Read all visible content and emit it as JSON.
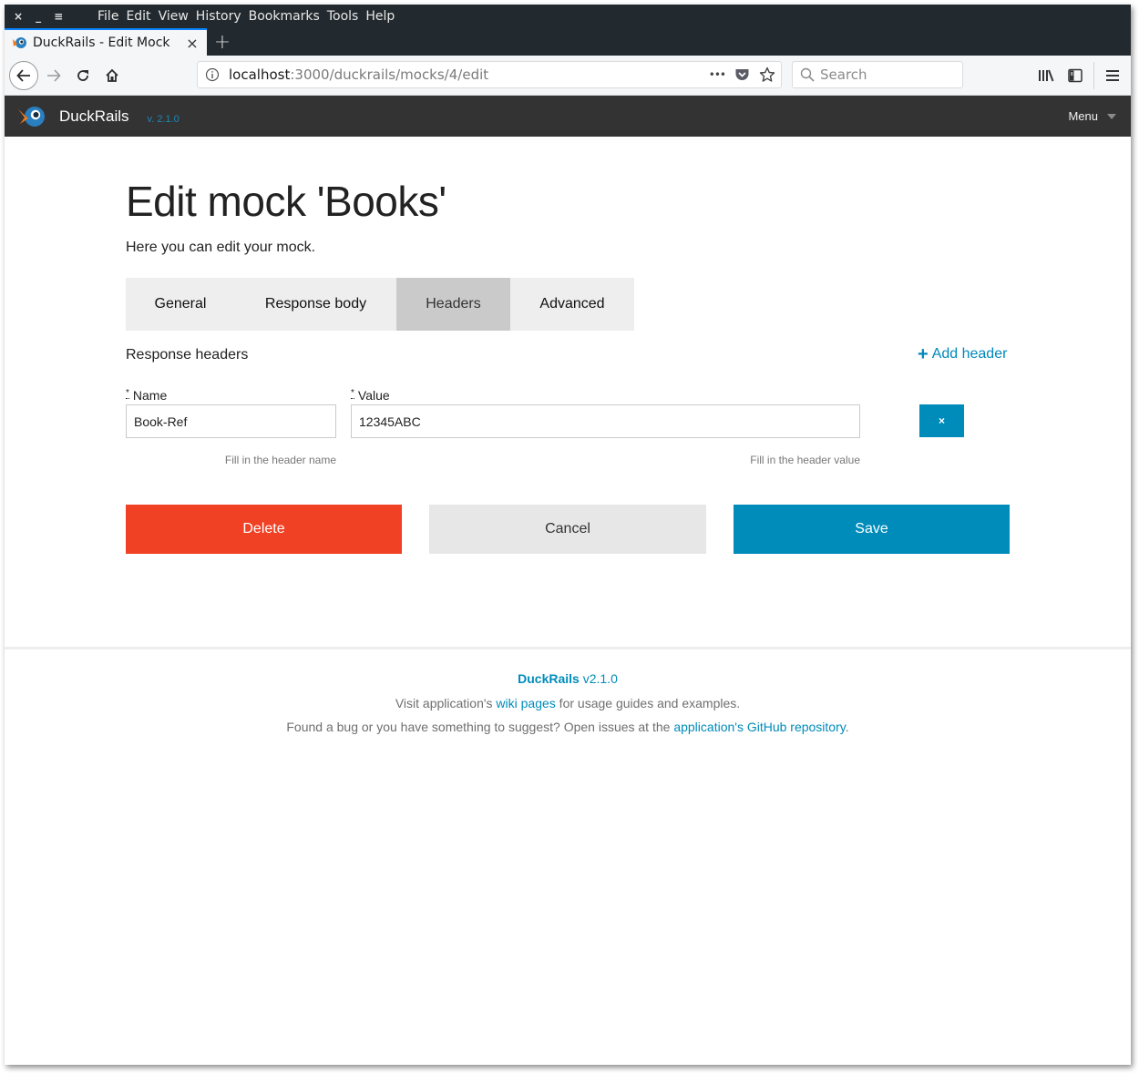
{
  "browser": {
    "window_controls": {
      "close": "×",
      "minimize": "_",
      "maximize": "≡"
    },
    "menu": [
      "File",
      "Edit",
      "View",
      "History",
      "Bookmarks",
      "Tools",
      "Help"
    ],
    "tab": {
      "title": "DuckRails - Edit Mock",
      "close": "×"
    },
    "new_tab": "+",
    "url": {
      "host": "localhost",
      "rest": ":3000/duckrails/mocks/4/edit"
    },
    "page_actions": "•••",
    "search": {
      "placeholder": "Search"
    }
  },
  "app": {
    "name": "DuckRails",
    "version": "v. 2.1.0",
    "menu_label": "Menu"
  },
  "page": {
    "title": "Edit mock 'Books'",
    "subtitle": "Here you can edit your mock.",
    "tabs": [
      {
        "label": "General",
        "active": false
      },
      {
        "label": "Response body",
        "active": false
      },
      {
        "label": "Headers",
        "active": true
      },
      {
        "label": "Advanced",
        "active": false
      }
    ],
    "section_label": "Response headers",
    "add_header_label": "Add header",
    "add_header_icon": "+",
    "required_marker": "*",
    "header_row": {
      "name_label": "Name",
      "name_value": "Book-Ref",
      "name_help": "Fill in the header name",
      "value_label": "Value",
      "value_value": "12345ABC",
      "value_help": "Fill in the header value",
      "remove_icon": "×"
    },
    "buttons": {
      "delete": "Delete",
      "cancel": "Cancel",
      "save": "Save"
    }
  },
  "footer": {
    "brand": "DuckRails",
    "version": "v2.1.0",
    "line2_prefix": "Visit application's ",
    "line2_link": "wiki pages",
    "line2_suffix": " for usage guides and examples.",
    "line3_prefix": "Found a bug or you have something to suggest? Open issues at the ",
    "line3_link": "application's GitHub repository",
    "line3_suffix": "."
  },
  "colors": {
    "primary": "#008cba",
    "danger": "#f04124",
    "secondary": "#e7e7e7",
    "app_nav": "#333333"
  }
}
